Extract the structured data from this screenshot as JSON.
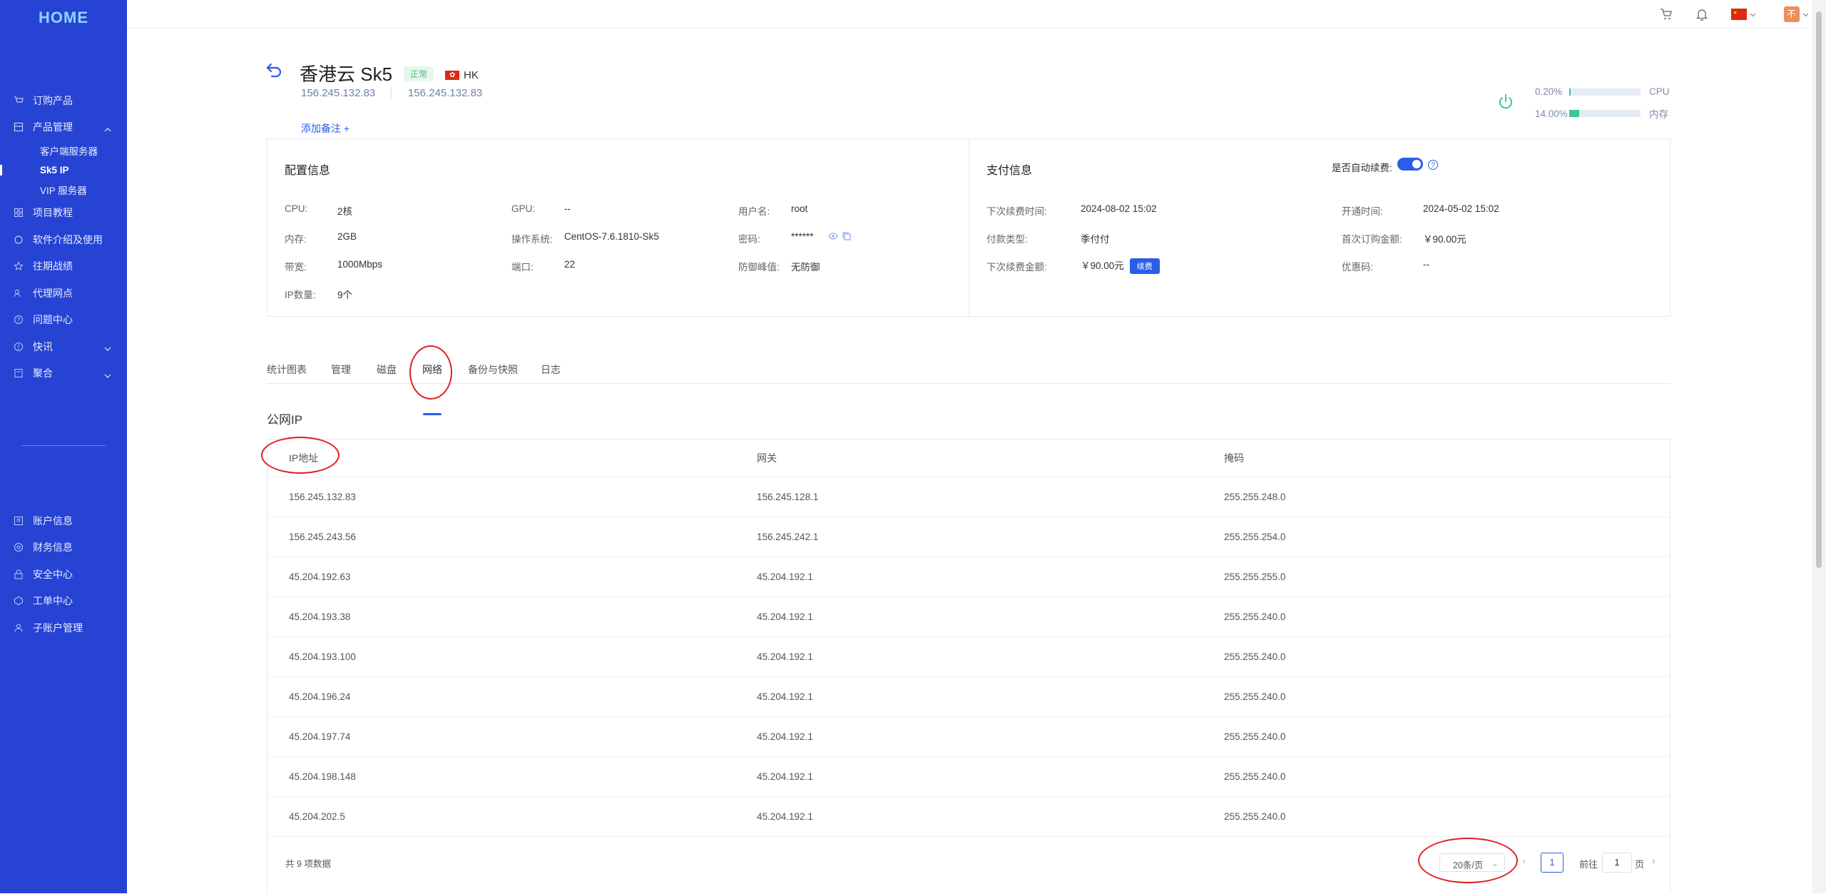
{
  "sidebar": {
    "logo": "HOME",
    "items": [
      {
        "label": "订购产品",
        "icon": "cart-icon"
      },
      {
        "label": "产品管理",
        "icon": "product-icon"
      }
    ],
    "subitems": [
      {
        "label": "客户端服务器"
      },
      {
        "label": "Sk5 IP"
      },
      {
        "label": "VIP 服务器"
      }
    ],
    "items_after": [
      {
        "label": "项目教程"
      },
      {
        "label": "软件介绍及使用"
      },
      {
        "label": "往期战绩"
      },
      {
        "label": "代理网点"
      },
      {
        "label": "问题中心"
      },
      {
        "label": "快讯"
      },
      {
        "label": "聚合"
      }
    ],
    "items_bottom": [
      {
        "label": "账户信息"
      },
      {
        "label": "财务信息"
      },
      {
        "label": "安全中心"
      },
      {
        "label": "工单中心"
      },
      {
        "label": "子账户管理"
      }
    ]
  },
  "topbar": {
    "avatar_text": "不"
  },
  "product": {
    "title": "香港云 Sk5",
    "status": "正常",
    "region": "HK",
    "ip_primary": "156.245.132.83",
    "ip_secondary": "156.245.132.83",
    "add_note": "添加备注 +",
    "cpu_usage": "0.20%",
    "cpu_label": "CPU",
    "cpu_fraction": 0.002,
    "mem_usage": "14.00%",
    "mem_label": "内存",
    "mem_fraction": 0.14
  },
  "config": {
    "title": "配置信息",
    "cpu_k": "CPU:",
    "cpu_v": "2核",
    "gpu_k": "GPU:",
    "gpu_v": "--",
    "user_k": "用户名:",
    "user_v": "root",
    "mem_k": "内存:",
    "mem_v": "2GB",
    "os_k": "操作系统:",
    "os_v": "CentOS-7.6.1810-Sk5",
    "pwd_k": "密码:",
    "pwd_v": "******",
    "bw_k": "带宽:",
    "bw_v": "1000Mbps",
    "port_k": "端口:",
    "port_v": "22",
    "ddos_k": "防御峰值:",
    "ddos_v": "无防御",
    "ipcount_k": "IP数量:",
    "ipcount_v": "9个"
  },
  "payment": {
    "title": "支付信息",
    "auto_renew_label": "是否自动续费:",
    "next_renew_k": "下次续费时间:",
    "next_renew_v": "2024-08-02 15:02",
    "open_time_k": "开通时间:",
    "open_time_v": "2024-05-02 15:02",
    "pay_type_k": "付款类型:",
    "pay_type_v": "季付付",
    "first_amount_k": "首次订购金额:",
    "first_amount_v": "￥90.00元",
    "next_amount_k": "下次续费金额:",
    "next_amount_v": "￥90.00元",
    "renew_button": "续费",
    "coupon_k": "优惠码:",
    "coupon_v": "--"
  },
  "tabs": [
    "统计图表",
    "管理",
    "磁盘",
    "网络",
    "备份与快照",
    "日志"
  ],
  "network": {
    "section_title": "公网IP",
    "columns": [
      "IP地址",
      "网关",
      "掩码"
    ],
    "rows": [
      [
        "156.245.132.83",
        "156.245.128.1",
        "255.255.248.0"
      ],
      [
        "156.245.243.56",
        "156.245.242.1",
        "255.255.254.0"
      ],
      [
        "45.204.192.63",
        "45.204.192.1",
        "255.255.255.0"
      ],
      [
        "45.204.193.38",
        "45.204.192.1",
        "255.255.240.0"
      ],
      [
        "45.204.193.100",
        "45.204.192.1",
        "255.255.240.0"
      ],
      [
        "45.204.196.24",
        "45.204.192.1",
        "255.255.240.0"
      ],
      [
        "45.204.197.74",
        "45.204.192.1",
        "255.255.240.0"
      ],
      [
        "45.204.198.148",
        "45.204.192.1",
        "255.255.240.0"
      ],
      [
        "45.204.202.5",
        "45.204.192.1",
        "255.255.240.0"
      ]
    ],
    "total": "共 9 项数据",
    "page_size": "20条/页",
    "current_page": "1",
    "goto_label": "前往",
    "goto_value": "1",
    "page_suffix": "页"
  }
}
